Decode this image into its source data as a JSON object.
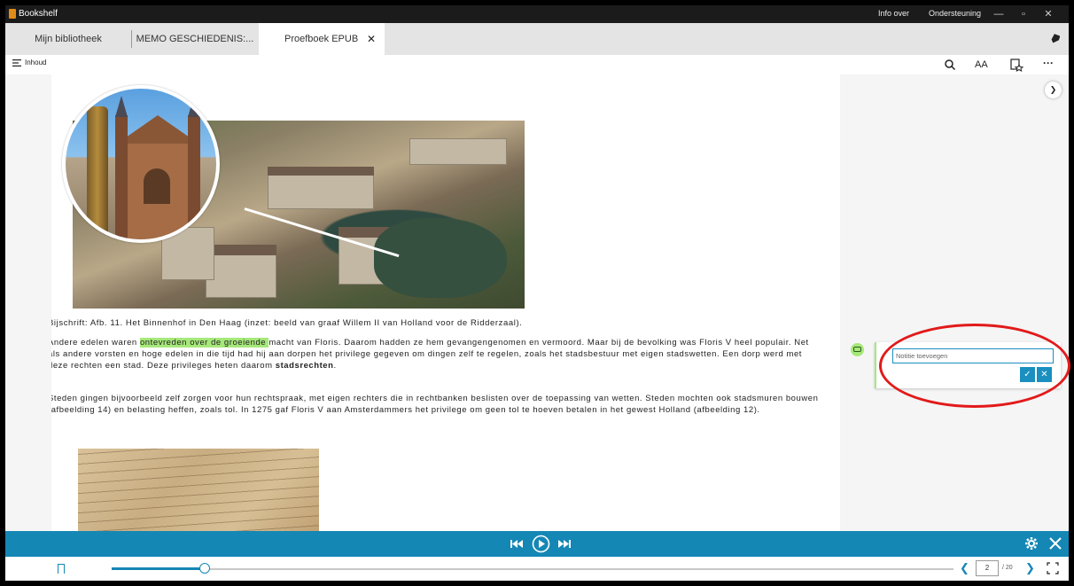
{
  "window": {
    "app_title": "Bookshelf",
    "links": [
      "Info over",
      "Ondersteuning"
    ],
    "controls": [
      "minimize-icon",
      "restore-icon",
      "close-icon"
    ]
  },
  "tabs": [
    {
      "label": "Mijn bibliotheek",
      "active": false
    },
    {
      "label": "MEMO GESCHIEDENIS:...",
      "active": false
    },
    {
      "label": "Proefboek EPUB",
      "active": true
    }
  ],
  "toolbar": {
    "toc_label": "Inhoud",
    "icons": [
      "search-icon",
      "font-size-icon",
      "bookmark-list-icon",
      "more-icon"
    ],
    "font_label": "AA"
  },
  "content": {
    "caption": "Bijschrift: Afb. 11. Het Binnenhof in Den Haag (inzet: beeld van graaf Willem II van Holland voor de Ridderzaal).",
    "para1_before": "Andere edelen waren ",
    "para1_highlight": "ontevreden over de groeiende ",
    "para1_after": "macht van Floris. Daarom hadden ze hem gevangengenomen en vermoord. Maar bij de bevolking was Floris V heel populair. Net als andere vorsten en hoge edelen in die tijd had hij aan dorpen het privilege gegeven om dingen zelf te regelen, zoals het stadsbestuur met eigen stadswetten. Een dorp werd met deze rechten een stad. Deze privileges heten daarom ",
    "para1_bold": "stadsrechten",
    "para1_end": ".",
    "para2": "Steden gingen bijvoorbeeld zelf zorgen voor hun rechtspraak, met eigen rechters die in rechtbanken beslisten over de toepassing van wetten. Steden mochten ook stadsmuren bouwen (afbeelding 14) en belasting heffen, zoals tol. In 1275 gaf Floris V aan Amsterdammers het privilege om geen tol te hoeven betalen in het gewest Holland (afbeelding 12)."
  },
  "note": {
    "placeholder": "Notitie toevoegen",
    "value": "",
    "highlight_color": "#a6e87a"
  },
  "player": {
    "icons": [
      "skip-back-icon",
      "play-icon",
      "skip-forward-icon",
      "settings-icon",
      "close-player-icon"
    ]
  },
  "navigation": {
    "current_page": "2",
    "total_pages": "/ 20",
    "progress": 0.11
  },
  "colors": {
    "accent": "#1587b5",
    "highlight": "#a6e87a",
    "annotation_ring": "#e21a1a"
  }
}
